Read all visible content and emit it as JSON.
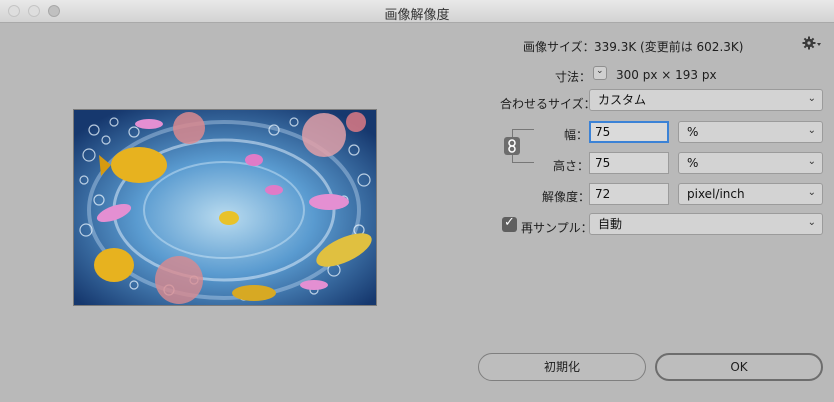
{
  "window": {
    "title": "画像解像度"
  },
  "info": {
    "image_size_label": "画像サイズ：",
    "image_size_value": "339.3K (変更前は 602.3K)",
    "dimensions_label": "寸法：",
    "dimensions_value": "300 px × 193 px"
  },
  "fit": {
    "label": "合わせるサイズ：",
    "value": "カスタム"
  },
  "width": {
    "label": "幅：",
    "value": "75",
    "unit": "%"
  },
  "height": {
    "label": "高さ：",
    "value": "75",
    "unit": "%"
  },
  "resolution": {
    "label": "解像度：",
    "value": "72",
    "unit": "pixel/inch"
  },
  "resample": {
    "label": "再サンプル：",
    "checked": true,
    "value": "自動"
  },
  "buttons": {
    "reset": "初期化",
    "ok": "OK"
  },
  "icons": {
    "settings": "gear-icon",
    "link": "chain-link-icon"
  },
  "colors": {
    "focus": "#3b82d6",
    "background": "#b9b9b9"
  }
}
